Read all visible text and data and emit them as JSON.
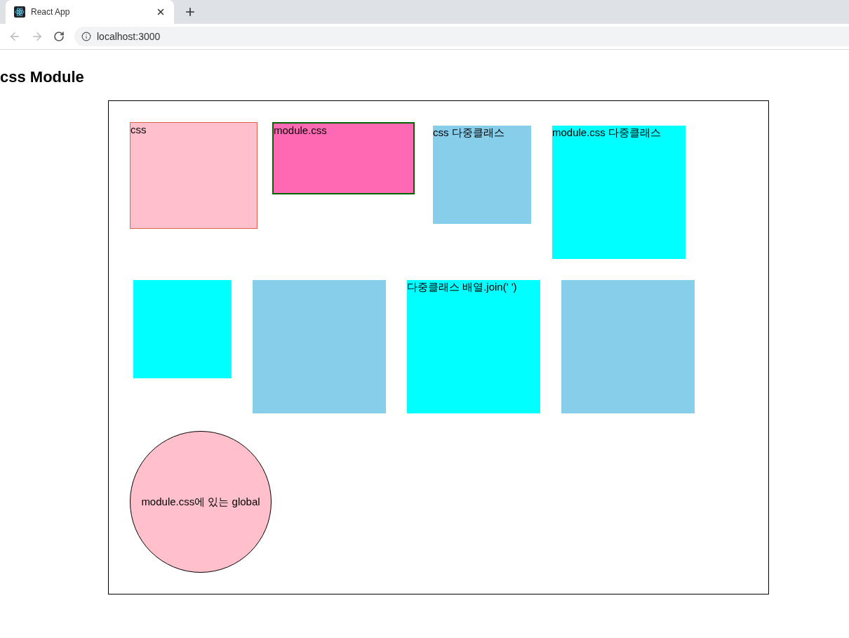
{
  "browser": {
    "tab_title": "React App",
    "url": "localhost:3000"
  },
  "heading": "css Module",
  "rows": [
    {
      "boxes": [
        {
          "kind": "outlined",
          "color": "#ffc0cb",
          "label": "css"
        },
        {
          "kind": "framed",
          "color": "#ff69b4",
          "label": "module.css"
        },
        {
          "kind": "small",
          "color": "#87ceeb",
          "label": "css 다중클래스"
        },
        {
          "kind": "large",
          "color": "#00ffff",
          "label": "module.css 다중클래스"
        }
      ]
    },
    {
      "boxes": [
        {
          "kind": "small",
          "color": "#00ffff"
        },
        {
          "kind": "large",
          "color": "#87ceeb"
        },
        {
          "kind": "large",
          "color": "#00ffff",
          "label": "다중클래스 배열.join(' ')"
        },
        {
          "kind": "large",
          "color": "#87ceeb"
        }
      ]
    },
    {
      "boxes": [
        {
          "kind": "circle",
          "color": "#ffc0cb",
          "label": "module.css에 있는 global"
        }
      ]
    }
  ]
}
